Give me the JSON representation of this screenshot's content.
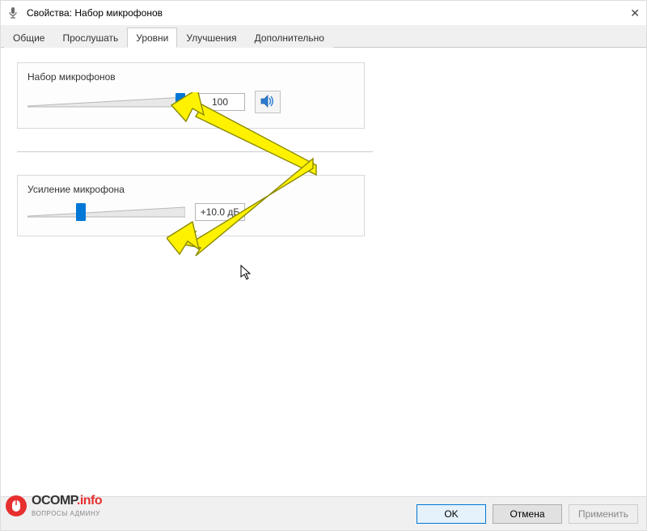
{
  "window": {
    "title": "Свойства: Набор микрофонов"
  },
  "tabs": {
    "t0": "Общие",
    "t1": "Прослушать",
    "t2": "Уровни",
    "t3": "Улучшения",
    "t4": "Дополнительно"
  },
  "group1": {
    "label": "Набор микрофонов",
    "value": "100",
    "slider_percent": 100
  },
  "group2": {
    "label": "Усиление микрофона",
    "value": "+10.0 дБ",
    "slider_percent": 33
  },
  "footer": {
    "ok": "OK",
    "cancel": "Отмена",
    "apply": "Применить"
  },
  "badge": {
    "main_a": "OCOMP",
    "main_b": ".info",
    "sub": "ВОПРОСЫ АДМИНУ"
  }
}
